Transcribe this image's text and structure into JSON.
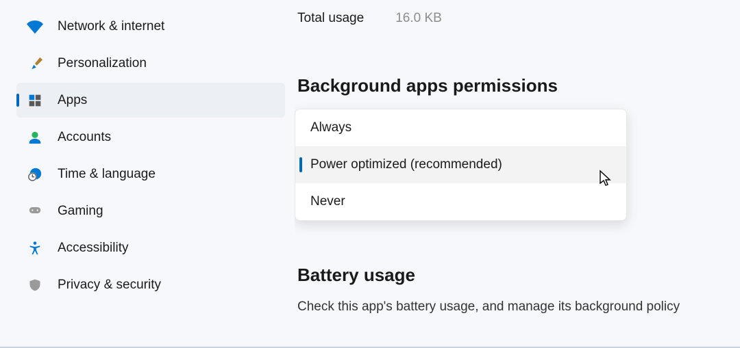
{
  "sidebar": {
    "items": [
      {
        "label": "Network & internet"
      },
      {
        "label": "Personalization"
      },
      {
        "label": "Apps"
      },
      {
        "label": "Accounts"
      },
      {
        "label": "Time & language"
      },
      {
        "label": "Gaming"
      },
      {
        "label": "Accessibility"
      },
      {
        "label": "Privacy & security"
      }
    ]
  },
  "totalUsage": {
    "label": "Total usage",
    "value": "16.0 KB"
  },
  "backgroundPermissions": {
    "title": "Background apps permissions",
    "options": [
      {
        "label": "Always"
      },
      {
        "label": "Power optimized (recommended)"
      },
      {
        "label": "Never"
      }
    ]
  },
  "battery": {
    "title": "Battery usage",
    "description": "Check this app's battery usage, and manage its background policy"
  }
}
